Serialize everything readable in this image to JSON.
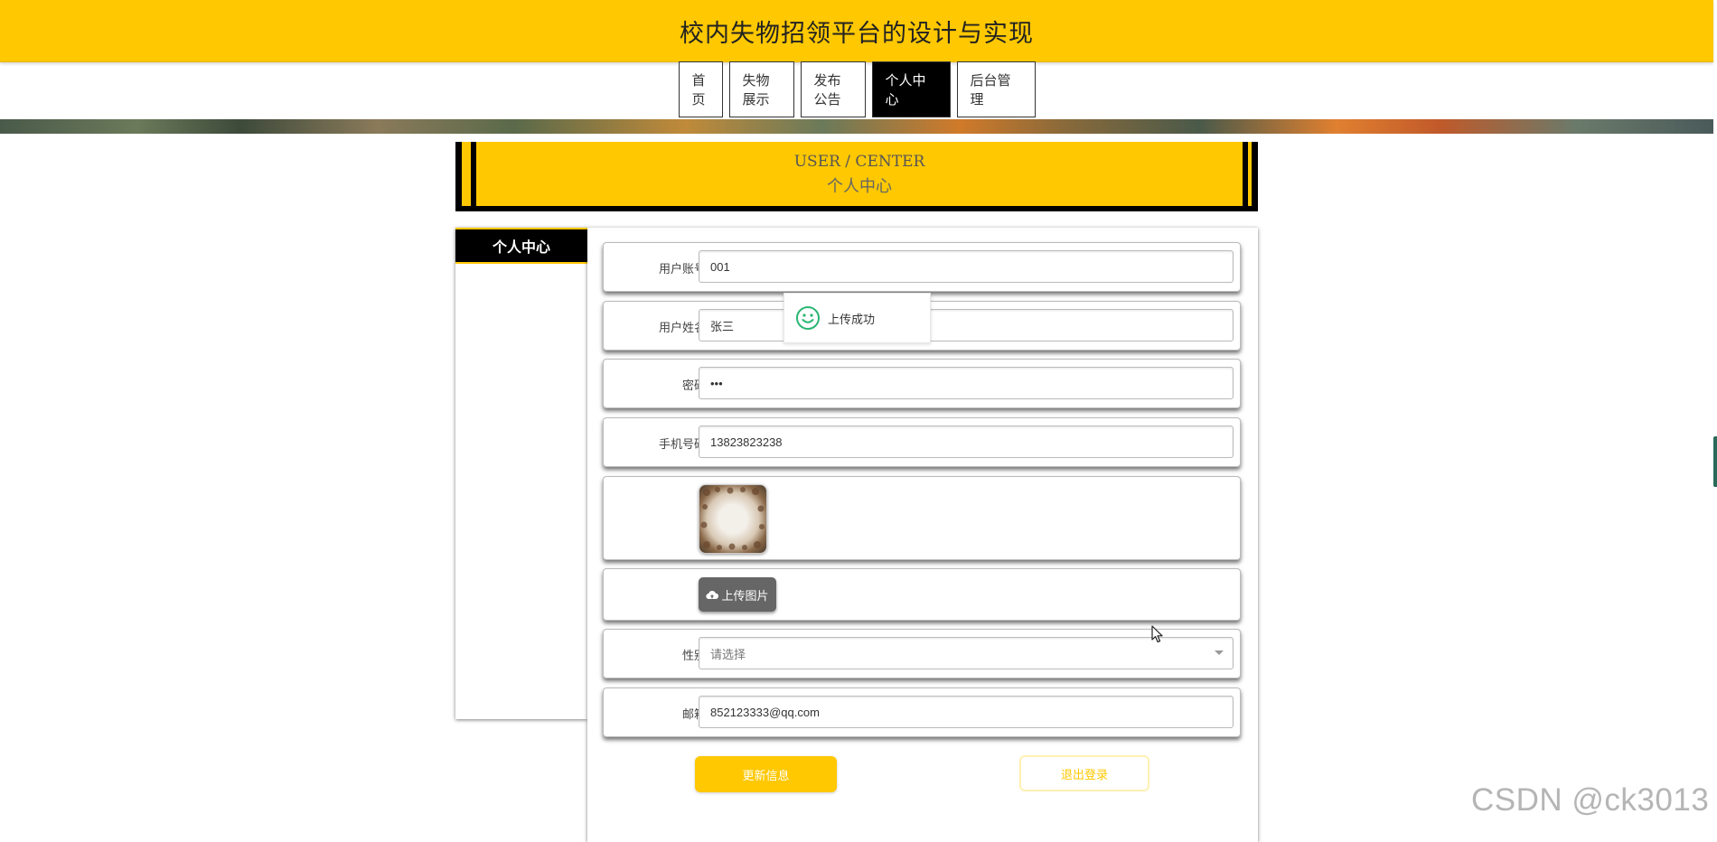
{
  "header": {
    "title": "校内失物招领平台的设计与实现"
  },
  "nav": {
    "items": [
      {
        "label": "首页"
      },
      {
        "label": "失物展示"
      },
      {
        "label": "发布公告"
      },
      {
        "label": "个人中心"
      },
      {
        "label": "后台管理"
      }
    ],
    "active_label": "个人中心"
  },
  "section": {
    "title_en": "USER / CENTER",
    "title_cn": "个人中心"
  },
  "sidebar": {
    "title": "个人中心"
  },
  "form": {
    "account_label": "用户账号",
    "account_value": "001",
    "name_label": "用户姓名",
    "name_value": "张三",
    "password_label": "密码",
    "password_value": "•••",
    "phone_label": "手机号码",
    "phone_value": "13823823238",
    "upload_button": "上传图片",
    "gender_label": "性别",
    "gender_placeholder": "请选择",
    "email_label": "邮箱",
    "email_value": "852123333@qq.com",
    "update_button": "更新信息",
    "logout_button": "退出登录"
  },
  "toast": {
    "message": "上传成功"
  },
  "watermark": {
    "text": "CSDN @ck3013"
  },
  "colors": {
    "accent": "#FFC800",
    "dark": "#000000",
    "success_icon": "#2BB673"
  },
  "icons": [
    "smile-icon",
    "cloud-upload-icon",
    "chevron-down-icon",
    "mouse-cursor-icon"
  ]
}
